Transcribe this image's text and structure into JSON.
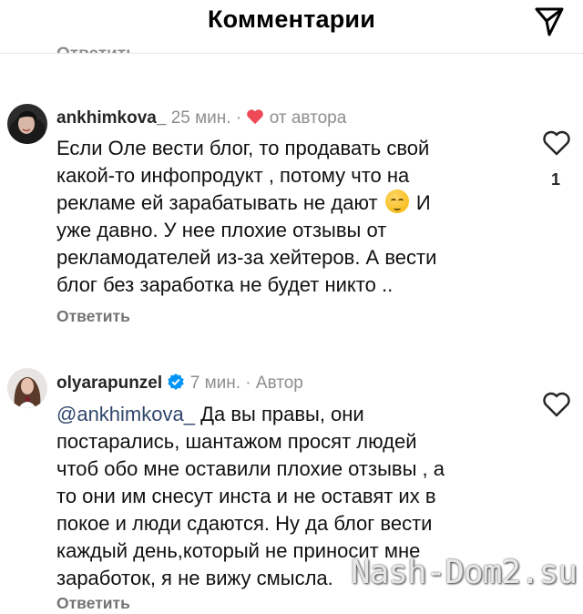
{
  "header": {
    "title": "Комментарии",
    "send_icon": "paper-plane-icon"
  },
  "partial_reply_label": "Ответить",
  "comments": [
    {
      "username": "ankhimkova_",
      "time": "25 мин.",
      "separator": "·",
      "badge_text": "от автора",
      "badge_icon": "heart-icon",
      "lines": [
        "Если Оле вести блог, то продавать свой",
        "какой-то инфопродукт , потому что на",
        "рекламе ей зарабатывать не дают",
        "И",
        "уже давно. У нее плохие отзывы от",
        "рекламодателей из-за хейтеров. А вести",
        "блог без заработка не будет никто .."
      ],
      "emoji": "pensive-face",
      "reply_label": "Ответить",
      "like_count": "1"
    },
    {
      "username": "olyarapunzel",
      "verified": true,
      "time": "7 мин.",
      "separator": "·",
      "author_label": "Автор",
      "mention": "@ankhimkova_",
      "lines": [
        " Да вы правы, они",
        "постарались, шантажом просят людей",
        "чтоб обо мне оставили плохие отзывы , а",
        "то они им снесут инста и не оставят их в",
        "покое и люди сдаются. Ну да блог вести",
        "каждый день,который не приносит мне",
        "заработок, я не вижу смысла."
      ],
      "reply_label": "Ответить"
    }
  ],
  "watermark": "Nash-Dom2.su",
  "colors": {
    "heart": "#ed4956",
    "verified": "#0095f6",
    "mention": "#30466c",
    "muted": "#8e8e8e"
  }
}
